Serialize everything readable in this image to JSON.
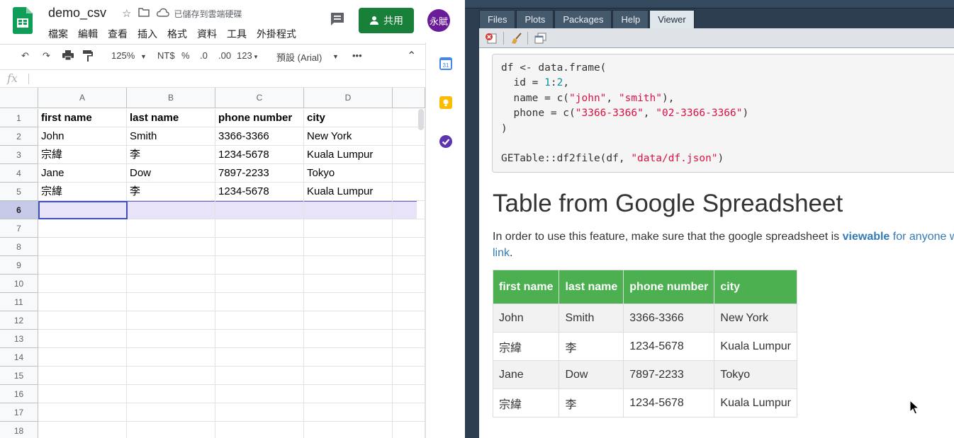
{
  "sheets": {
    "doc_title": "demo_csv",
    "saved_status": "已儲存到雲端硬碟",
    "menu": [
      "檔案",
      "編輯",
      "查看",
      "插入",
      "格式",
      "資料",
      "工具",
      "外掛程式"
    ],
    "share_label": "共用",
    "avatar_text": "永賦",
    "toolbar": {
      "zoom": "125%",
      "currency": "NT$",
      "percent": "%",
      "dec_less": ".0",
      "dec_more": ".00",
      "format": "123",
      "font": "預設 (Arial)",
      "more": "•••"
    },
    "fx_label": "fx",
    "columns": [
      "A",
      "B",
      "C",
      "D"
    ],
    "rows": [
      "1",
      "2",
      "3",
      "4",
      "5",
      "6",
      "7",
      "8",
      "9",
      "10",
      "11",
      "12",
      "13",
      "14",
      "15",
      "16",
      "17",
      "18"
    ],
    "cells": [
      [
        "first name",
        "last name",
        "phone number",
        "city"
      ],
      [
        "John",
        "Smith",
        "3366-3366",
        "New York"
      ],
      [
        "宗緯",
        "李",
        "1234-5678",
        "Kuala Lumpur"
      ],
      [
        "Jane",
        "Dow",
        "7897-2233",
        "Tokyo"
      ],
      [
        "宗緯",
        "李",
        "1234-5678",
        "Kuala Lumpur"
      ]
    ],
    "selected_row": "6"
  },
  "rstudio": {
    "tabs": [
      "Files",
      "Plots",
      "Packages",
      "Help",
      "Viewer"
    ],
    "active_tab": "Viewer",
    "code": {
      "l1": "df <- data.frame(",
      "l2a": "  id = ",
      "l2b": "1",
      "l2c": ":",
      "l2d": "2",
      "l2e": ",",
      "l3a": "  name = c(",
      "l3b": "\"john\"",
      "l3c": ", ",
      "l3d": "\"smith\"",
      "l3e": "),",
      "l4a": "  phone = c(",
      "l4b": "\"3366-3366\"",
      "l4c": ", ",
      "l4d": "\"02-3366-3366\"",
      "l4e": ")",
      "l5": ")",
      "l7a": "GETable::df2file(df, ",
      "l7b": "\"data/df.json\"",
      "l7c": ")"
    },
    "heading": "Table from Google Spreadsheet",
    "para_before": "In order to use this feature, make sure that the google spreadsheet is ",
    "para_bold": "viewable",
    "para_link": " for anyone with the",
    "para_link2": "link",
    "para_end": ".",
    "table_headers": [
      "first name",
      "last name",
      "phone number",
      "city"
    ],
    "table_rows": [
      [
        "John",
        "Smith",
        "3366-3366",
        "New York"
      ],
      [
        "宗緯",
        "李",
        "1234-5678",
        "Kuala Lumpur"
      ],
      [
        "Jane",
        "Dow",
        "7897-2233",
        "Tokyo"
      ],
      [
        "宗緯",
        "李",
        "1234-5678",
        "Kuala Lumpur"
      ]
    ],
    "colors": {
      "header_green": "#4caf50",
      "link_blue": "#337ab7"
    }
  }
}
